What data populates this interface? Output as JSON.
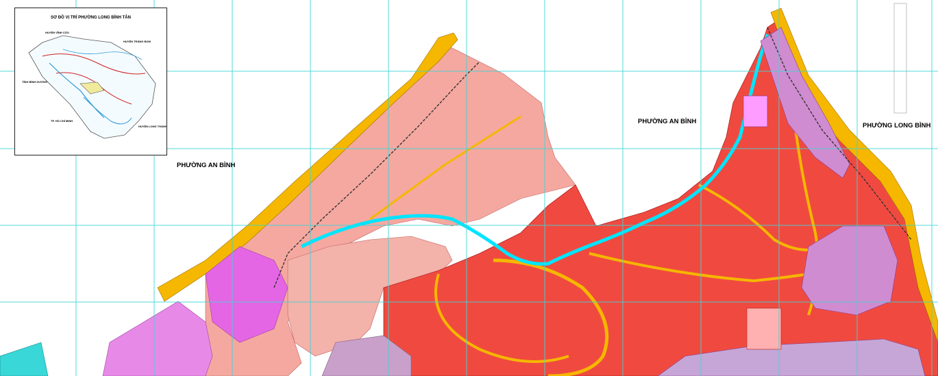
{
  "map": {
    "wards": [
      {
        "id": "an-binh-west",
        "name": "PHƯỜNG AN BÌNH"
      },
      {
        "id": "an-binh-east",
        "name": "PHƯỜNG AN BÌNH"
      },
      {
        "id": "long-binh",
        "name": "PHƯỜNG LONG BÌNH"
      }
    ],
    "colors": {
      "river": "#00ffff",
      "residential": "#ff4d4d",
      "industrial": "#f5a8a0",
      "roads": "#f5b700",
      "mixed_use": "#e66ce6",
      "grid": "#3fd6d6"
    }
  },
  "inset": {
    "title": "SƠ ĐỒ VỊ TRÍ PHƯỜNG LONG BÌNH TÂN",
    "labels": {
      "vinh_cuu": "HUYỆN VĨNH CỬU",
      "trang_bom": "HUYỆN TRẢNG BOM",
      "binh_duong": "TỈNH BÌNH DƯƠNG",
      "hcm": "TP. HỒ CHÍ MINH",
      "long_thanh": "HUYỆN LONG THÀNH"
    }
  }
}
